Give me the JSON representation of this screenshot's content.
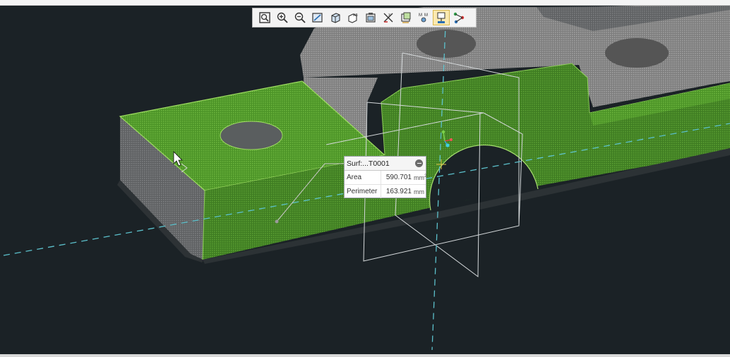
{
  "toolbar": {
    "buttons": [
      {
        "icon": "zoom-fit-icon",
        "active": false
      },
      {
        "icon": "zoom-in-icon",
        "active": false
      },
      {
        "icon": "zoom-out-icon",
        "active": false
      },
      {
        "icon": "zoom-window-icon",
        "active": false
      },
      {
        "icon": "view-orientation-icon",
        "active": false
      },
      {
        "icon": "display-style-icon",
        "active": false
      },
      {
        "icon": "saved-views-icon",
        "active": false
      },
      {
        "icon": "datum-display-icon",
        "active": false
      },
      {
        "icon": "annotation-display-icon",
        "active": false
      },
      {
        "icon": "measure-icon",
        "active": false
      },
      {
        "icon": "section-icon",
        "active": true
      },
      {
        "icon": "spin-center-icon",
        "active": false
      }
    ]
  },
  "measure_panel": {
    "title": "Surf:...T0001",
    "rows": [
      {
        "label": "Area",
        "value": "590.701",
        "unit": "mm",
        "unit_sup": "2"
      },
      {
        "label": "Perimeter",
        "value": "163.921",
        "unit": "mm",
        "unit_sup": ""
      }
    ]
  },
  "colors": {
    "background": "#1b2226",
    "selected_face": "#4f8f2a",
    "gray_part": "#8a8a8a",
    "axis_line": "#4fb3c0"
  }
}
